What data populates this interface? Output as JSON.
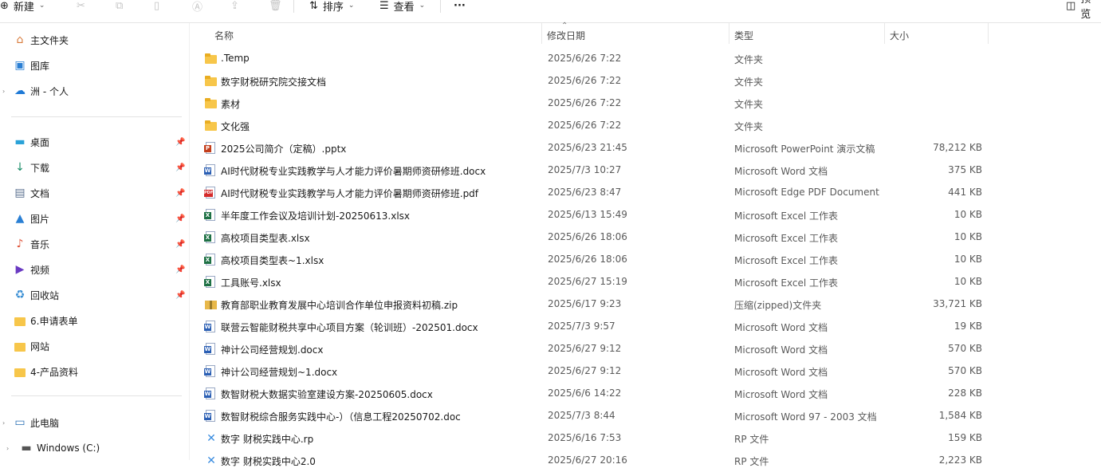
{
  "toolbar": {
    "new_label": "新建",
    "sort_label": "排序",
    "view_label": "查看",
    "more_label": "···",
    "preview_label": "预览"
  },
  "sidebar": {
    "top": [
      {
        "label": "主文件夹",
        "icon": "home-icon"
      },
      {
        "label": "图库",
        "icon": "gallery-icon"
      },
      {
        "label": "洲 - 个人",
        "icon": "cloud-icon"
      }
    ],
    "quick": [
      {
        "label": "桌面",
        "icon": "desktop-icon",
        "pinned": true
      },
      {
        "label": "下载",
        "icon": "download-icon",
        "pinned": true
      },
      {
        "label": "文档",
        "icon": "documents-icon",
        "pinned": true
      },
      {
        "label": "图片",
        "icon": "pictures-icon",
        "pinned": true
      },
      {
        "label": "音乐",
        "icon": "music-icon",
        "pinned": true
      },
      {
        "label": "视频",
        "icon": "videos-icon",
        "pinned": true
      },
      {
        "label": "回收站",
        "icon": "recycle-bin-icon",
        "pinned": true
      },
      {
        "label": "6.申请表单",
        "icon": "folder-icon",
        "pinned": false
      },
      {
        "label": "网站",
        "icon": "folder-icon",
        "pinned": false
      },
      {
        "label": "4-产品资料",
        "icon": "folder-icon",
        "pinned": false
      }
    ],
    "bottom": [
      {
        "label": "此电脑",
        "icon": "computer-icon"
      },
      {
        "label": "Windows (C:)",
        "icon": "drive-icon"
      }
    ]
  },
  "columns": {
    "name": "名称",
    "date": "修改日期",
    "type": "类型",
    "size": "大小"
  },
  "files": [
    {
      "name": ".Temp",
      "date": "2025/6/26 7:22",
      "type": "文件夹",
      "size": "",
      "icon": "folder"
    },
    {
      "name": "数字财税研究院交接文档",
      "date": "2025/6/26 7:22",
      "type": "文件夹",
      "size": "",
      "icon": "folder"
    },
    {
      "name": "素材",
      "date": "2025/6/26 7:22",
      "type": "文件夹",
      "size": "",
      "icon": "folder"
    },
    {
      "name": "文化强",
      "date": "2025/6/26 7:22",
      "type": "文件夹",
      "size": "",
      "icon": "folder"
    },
    {
      "name": "2025公司简介（定稿）.pptx",
      "date": "2025/6/23 21:45",
      "type": "Microsoft PowerPoint 演示文稿",
      "size": "78,212 KB",
      "icon": "pptx"
    },
    {
      "name": "AI时代财税专业实践教学与人才能力评价暑期师资研修班.docx",
      "date": "2025/7/3 10:27",
      "type": "Microsoft Word 文档",
      "size": "375 KB",
      "icon": "docx"
    },
    {
      "name": "AI时代财税专业实践教学与人才能力评价暑期师资研修班.pdf",
      "date": "2025/6/23 8:47",
      "type": "Microsoft Edge PDF Document",
      "size": "441 KB",
      "icon": "pdf"
    },
    {
      "name": "半年度工作会议及培训计划-20250613.xlsx",
      "date": "2025/6/13 15:49",
      "type": "Microsoft Excel 工作表",
      "size": "10 KB",
      "icon": "xlsx"
    },
    {
      "name": "高校项目类型表.xlsx",
      "date": "2025/6/26 18:06",
      "type": "Microsoft Excel 工作表",
      "size": "10 KB",
      "icon": "xlsx"
    },
    {
      "name": "高校项目类型表~1.xlsx",
      "date": "2025/6/26 18:06",
      "type": "Microsoft Excel 工作表",
      "size": "10 KB",
      "icon": "xlsx"
    },
    {
      "name": "工具账号.xlsx",
      "date": "2025/6/27 15:19",
      "type": "Microsoft Excel 工作表",
      "size": "10 KB",
      "icon": "xlsx"
    },
    {
      "name": "教育部职业教育发展中心培训合作单位申报资料初稿.zip",
      "date": "2025/6/17 9:23",
      "type": "压缩(zipped)文件夹",
      "size": "33,721 KB",
      "icon": "zip"
    },
    {
      "name": "联营云智能财税共享中心项目方案（轮训班）-202501.docx",
      "date": "2025/7/3 9:57",
      "type": "Microsoft Word 文档",
      "size": "19 KB",
      "icon": "docx"
    },
    {
      "name": "神计公司经营规划.docx",
      "date": "2025/6/27 9:12",
      "type": "Microsoft Word 文档",
      "size": "570 KB",
      "icon": "docx"
    },
    {
      "name": "神计公司经营规划~1.docx",
      "date": "2025/6/27 9:12",
      "type": "Microsoft Word 文档",
      "size": "570 KB",
      "icon": "docx"
    },
    {
      "name": "数智财税大数据实验室建设方案-20250605.docx",
      "date": "2025/6/6 14:22",
      "type": "Microsoft Word 文档",
      "size": "228 KB",
      "icon": "docx"
    },
    {
      "name": "数智财税综合服务实践中心-）（信息工程20250702.doc",
      "date": "2025/7/3 8:44",
      "type": "Microsoft Word 97 - 2003 文档",
      "size": "1,584 KB",
      "icon": "doc"
    },
    {
      "name": "数字 财税实践中心.rp",
      "date": "2025/6/16 7:53",
      "type": "RP 文件",
      "size": "159 KB",
      "icon": "rp"
    },
    {
      "name": "数字 财税实践中心2.0",
      "date": "2025/6/27 20:16",
      "type": "RP 文件",
      "size": "2,223 KB",
      "icon": "rp"
    }
  ],
  "colors": {
    "folder": "#f7c64a",
    "word": "#2b5fb4",
    "excel": "#1e7145",
    "powerpoint": "#c43e1c",
    "pdf": "#d42a2a",
    "rp": "#3b8de0"
  }
}
